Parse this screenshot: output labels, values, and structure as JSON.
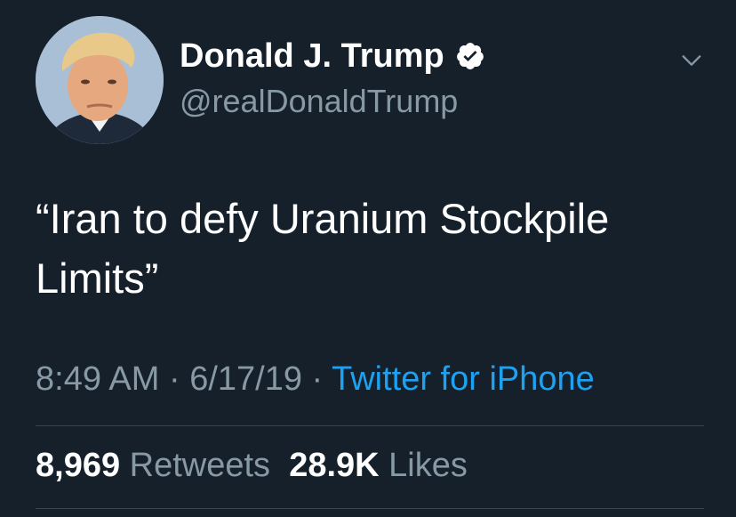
{
  "author": {
    "display_name": "Donald J. Trump",
    "handle": "@realDonaldTrump",
    "verified": true,
    "avatar_icon": "profile-photo"
  },
  "tweet": {
    "text": "“Iran to defy Uranium Stockpile Limits”",
    "time": "8:49 AM",
    "separator_1": " · ",
    "date": "6/17/19",
    "separator_2": " · ",
    "source": "Twitter for iPhone"
  },
  "stats": {
    "retweets_count": "8,969",
    "retweets_label": "Retweets",
    "likes_count": "28.9K",
    "likes_label": "Likes"
  },
  "colors": {
    "background": "#15202b",
    "text_primary": "#ffffff",
    "text_secondary": "#8899a6",
    "link": "#1da1f2",
    "divider": "#38444d"
  },
  "icons": {
    "verified": "verified-badge-icon",
    "menu": "chevron-down-icon"
  }
}
